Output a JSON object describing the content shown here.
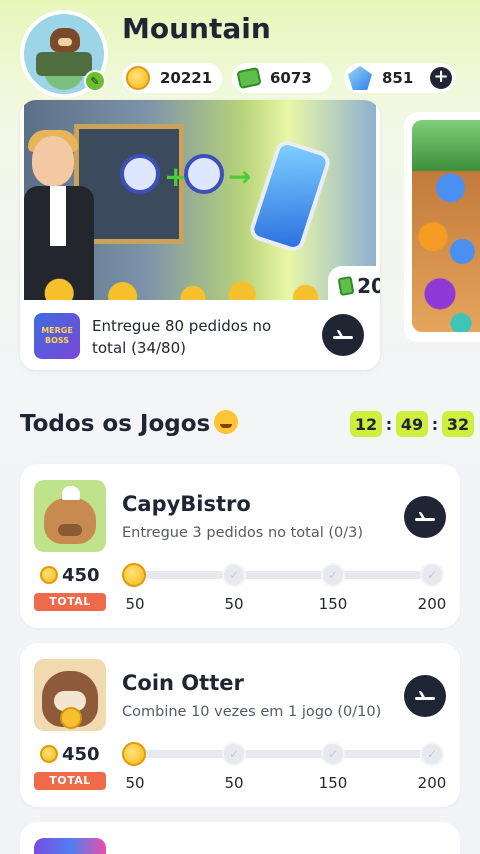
{
  "profile": {
    "name": "Mountain",
    "currencies": {
      "coins": "20221",
      "cash": "6073",
      "gems": "851"
    }
  },
  "banner": {
    "reward": "20",
    "game_icon_text": "MERGE BOSS",
    "task": "Entregue 80 pedidos no total (34/80)"
  },
  "section": {
    "title": "Todos os Jogos",
    "timer": {
      "hours": "12",
      "minutes": "49",
      "seconds": "32"
    }
  },
  "games": [
    {
      "name": "CapyBistro",
      "task": "Entregue 3 pedidos no total (0/3)",
      "total": "450",
      "total_label": "TOTAL",
      "milestones": [
        "50",
        "50",
        "150",
        "200"
      ],
      "progress": 0
    },
    {
      "name": "Coin Otter",
      "task": "Combine 10 vezes em 1 jogo (0/10)",
      "total": "450",
      "total_label": "TOTAL",
      "milestones": [
        "50",
        "50",
        "150",
        "200"
      ],
      "progress": 0
    }
  ],
  "icons": {
    "coin": "coin-icon",
    "cash": "cash-icon",
    "gem": "gem-icon",
    "go": "arrow-right-icon",
    "edit": "edit-icon"
  },
  "colors": {
    "accent": "#cfee3e",
    "total_badge": "#ef6a4a",
    "dark_button": "#1f2533"
  }
}
